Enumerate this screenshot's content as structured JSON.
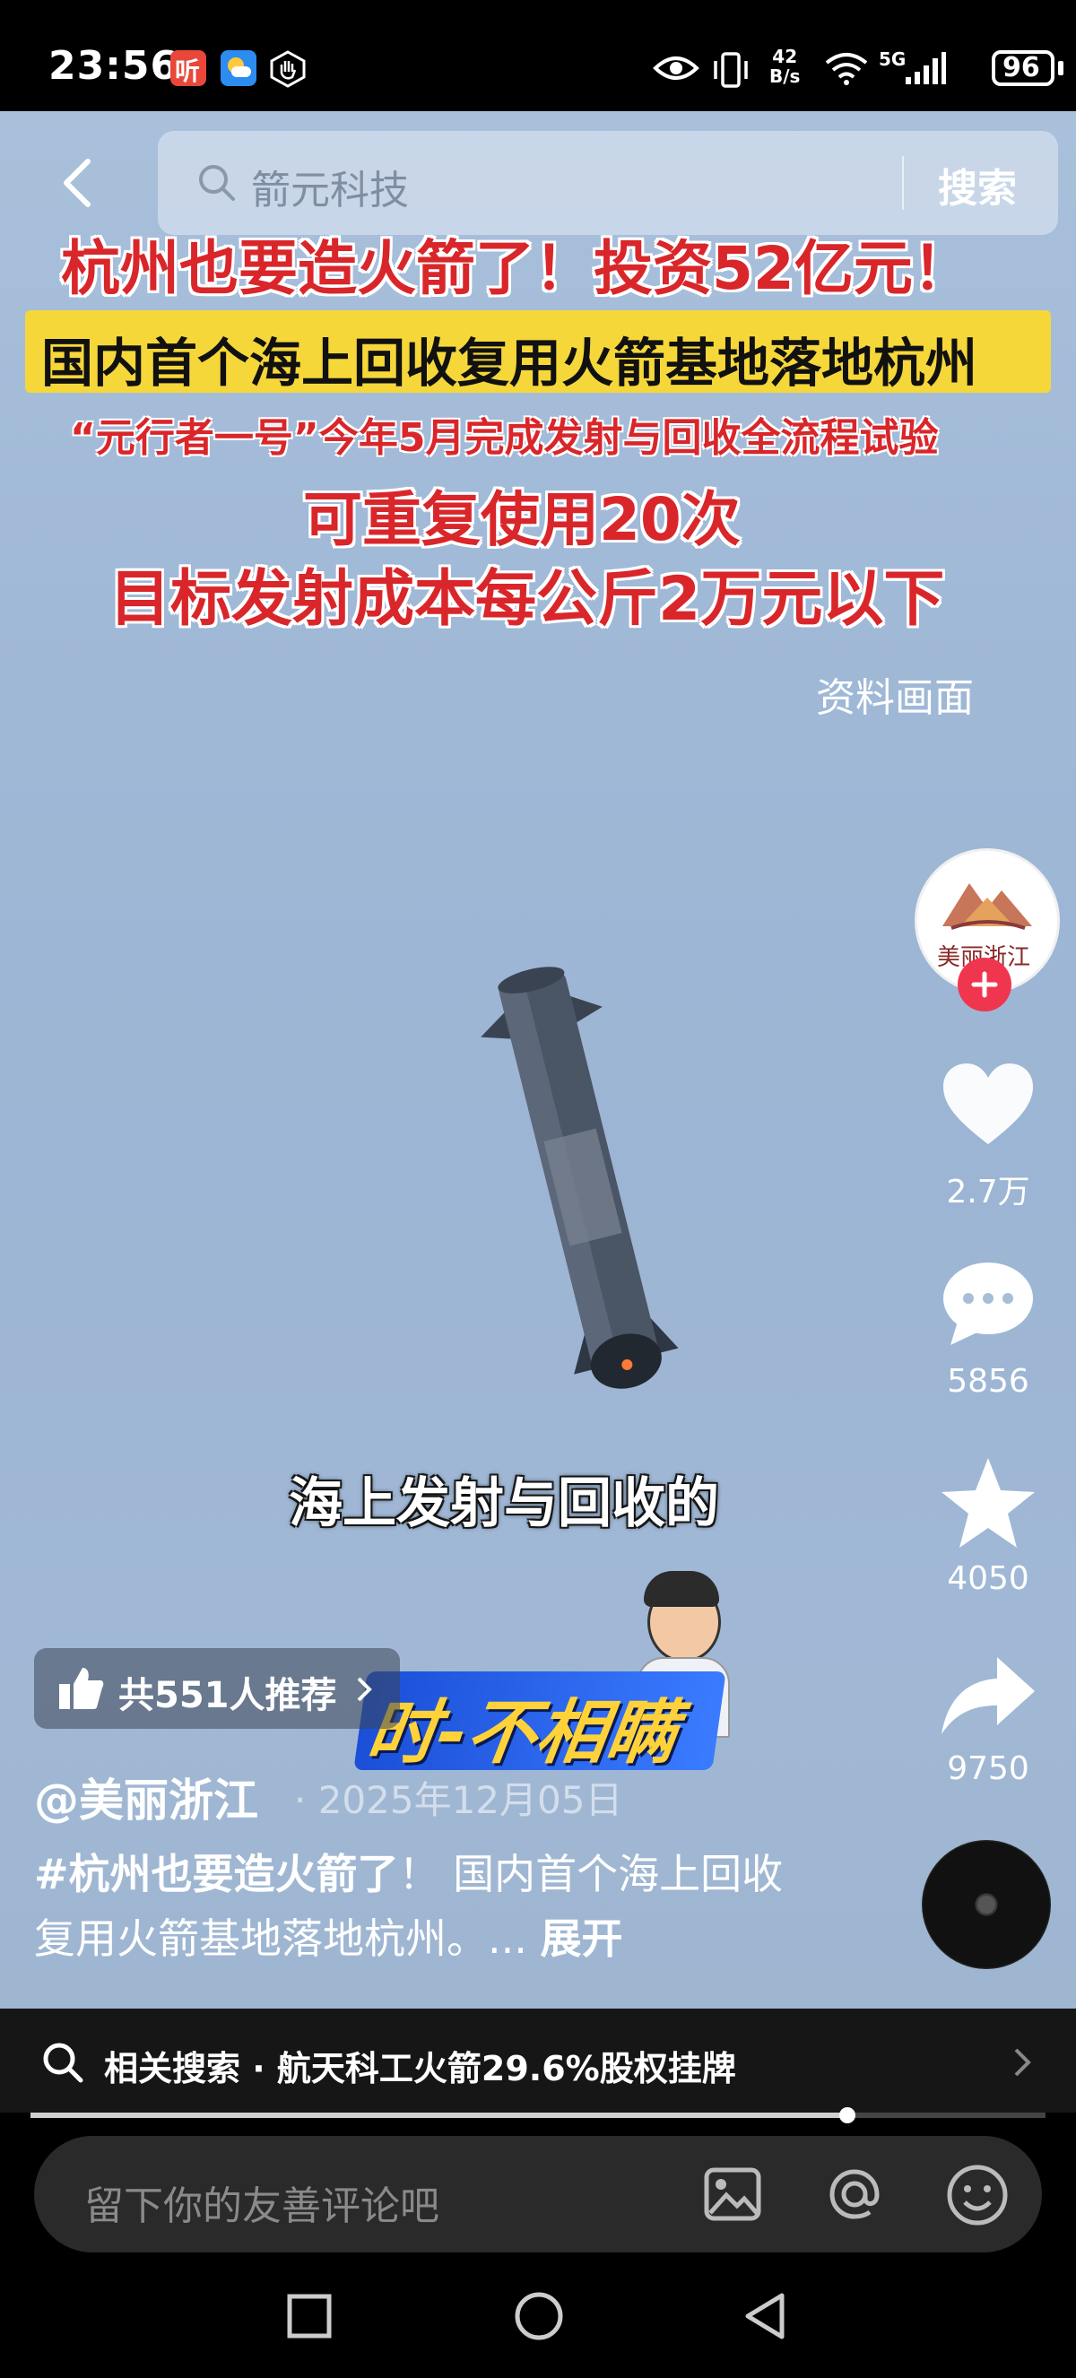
{
  "status_bar": {
    "time": "23:56",
    "net_speed_top": "42",
    "net_speed_unit": "B/s",
    "network": "5G",
    "battery": "96"
  },
  "search": {
    "query": "箭元科技",
    "button_label": "搜索"
  },
  "overlay": {
    "headline_1": "杭州也要造火箭了！投资52亿元！",
    "banner": "国内首个海上回收复用火箭基地落地杭州",
    "headline_3": "“元行者一号”今年5月完成发射与回收全流程试验",
    "headline_4": "可重复使用20次",
    "headline_5": "目标发射成本每公斤2万元以下",
    "footage_label": "资料画面",
    "subtitle": "海上发射与回收的",
    "logo_text": "时-不相瞒"
  },
  "sidebar": {
    "avatar_text": "美丽浙江",
    "likes": "2.7万",
    "comments": "5856",
    "favorites": "4050",
    "shares": "9750"
  },
  "post": {
    "recommend": "共551人推荐",
    "author": "@美丽浙江",
    "date": "· 2025年12月05日",
    "caption_hashtag": "#杭州也要造火箭了",
    "caption_body": "！ 国内首个海上回收复用火箭基地落地杭州。...",
    "expand": "展开"
  },
  "related_search": {
    "label": "相关搜索 · 航天科工火箭29.6%股权挂牌"
  },
  "progress": {
    "fraction": 0.805
  },
  "comment": {
    "placeholder": "留下你的友善评论吧"
  },
  "colors": {
    "accent_red": "#d9262a",
    "banner_yellow": "#f6d73a"
  }
}
